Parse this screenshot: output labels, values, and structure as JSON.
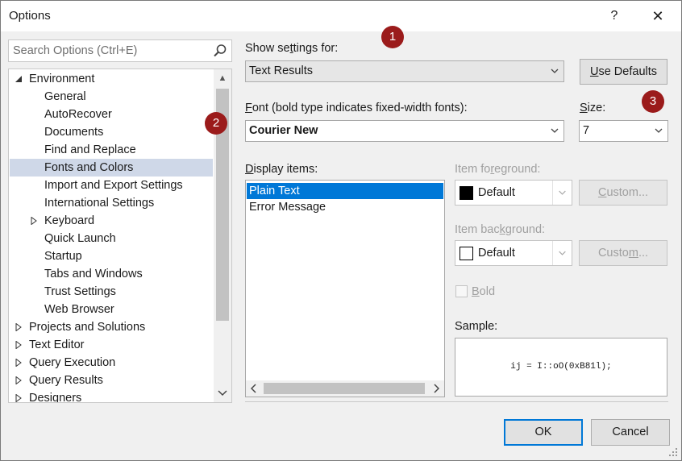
{
  "window": {
    "title": "Options",
    "help_label": "?",
    "close_label": "✕"
  },
  "callouts": [
    "1",
    "2",
    "3"
  ],
  "search": {
    "placeholder": "Search Options (Ctrl+E)"
  },
  "tree": {
    "items": [
      {
        "label": "Environment",
        "level": 0,
        "expanded": true
      },
      {
        "label": "General",
        "level": 1
      },
      {
        "label": "AutoRecover",
        "level": 1
      },
      {
        "label": "Documents",
        "level": 1
      },
      {
        "label": "Find and Replace",
        "level": 1
      },
      {
        "label": "Fonts and Colors",
        "level": 1,
        "selected": true
      },
      {
        "label": "Import and Export Settings",
        "level": 1
      },
      {
        "label": "International Settings",
        "level": 1
      },
      {
        "label": "Keyboard",
        "level": 1,
        "collapsed": true
      },
      {
        "label": "Quick Launch",
        "level": 1
      },
      {
        "label": "Startup",
        "level": 1
      },
      {
        "label": "Tabs and Windows",
        "level": 1
      },
      {
        "label": "Trust Settings",
        "level": 1
      },
      {
        "label": "Web Browser",
        "level": 1
      },
      {
        "label": "Projects and Solutions",
        "level": 0,
        "collapsed": true
      },
      {
        "label": "Text Editor",
        "level": 0,
        "collapsed": true
      },
      {
        "label": "Query Execution",
        "level": 0,
        "collapsed": true
      },
      {
        "label": "Query Results",
        "level": 0,
        "collapsed": true
      },
      {
        "label": "Designers",
        "level": 0,
        "collapsed": true
      }
    ]
  },
  "show_settings": {
    "label_pre": "Show se",
    "label_key": "t",
    "label_post": "tings for:",
    "value": "Text Results"
  },
  "use_defaults": {
    "key": "U",
    "rest": "se Defaults"
  },
  "font": {
    "label_key": "F",
    "label_rest": "ont (bold type indicates fixed-width fonts):",
    "value": "Courier New"
  },
  "size": {
    "label_key": "S",
    "label_rest": "ize:",
    "value": "7"
  },
  "display_items": {
    "label_key": "D",
    "label_rest": "isplay items:",
    "items": [
      "Plain Text",
      "Error Message"
    ],
    "selected_index": 0
  },
  "item_foreground": {
    "label_pre": "Item fo",
    "label_key": "r",
    "label_post": "eground:",
    "value": "Default",
    "swatch": "#000000",
    "custom_pre": "",
    "custom_key": "C",
    "custom_post": "ustom..."
  },
  "item_background": {
    "label_pre": "Item bac",
    "label_key": "k",
    "label_post": "ground:",
    "value": "Default",
    "swatch": "#ffffff",
    "custom_pre": "Custo",
    "custom_key": "m",
    "custom_post": "..."
  },
  "bold": {
    "label_key": "B",
    "label_rest": "old",
    "checked": false
  },
  "sample": {
    "label": "Sample:",
    "text": "ij = I::oO(0xB81l);"
  },
  "ok_label": "OK",
  "cancel_label": "Cancel",
  "colors": {
    "accent": "#0078d7",
    "callout": "#9b1b1b",
    "tree_selected": "#cfd8e8"
  }
}
